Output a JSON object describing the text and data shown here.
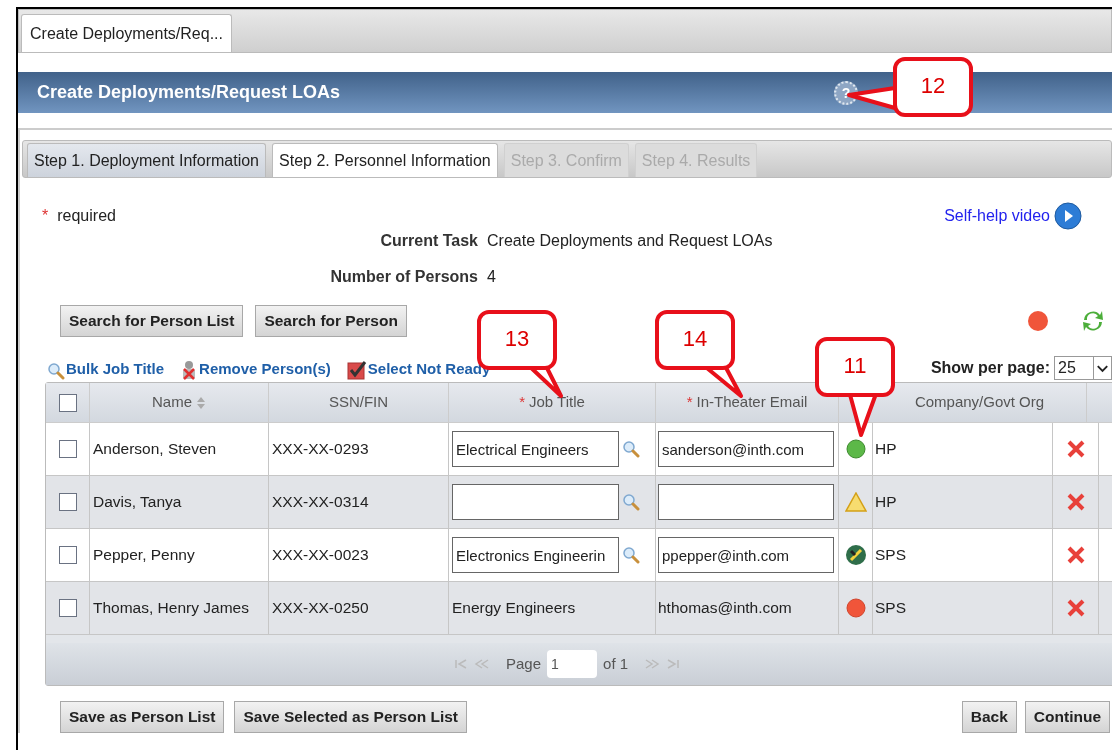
{
  "window_tab": {
    "label": "Create Deployments/Req...",
    "selected": true
  },
  "header": {
    "title": "Create Deployments/Request LOAs",
    "help_icon": "?"
  },
  "steps": [
    {
      "label": "Step 1. Deployment Information",
      "selected": false,
      "disabled": false
    },
    {
      "label": "Step 2. Personnel Information",
      "selected": true,
      "disabled": false
    },
    {
      "label": "Step 3. Confirm",
      "selected": false,
      "disabled": true
    },
    {
      "label": "Step 4. Results",
      "selected": false,
      "disabled": true
    }
  ],
  "required_note": {
    "mark": "*",
    "text": "required"
  },
  "self_help_link": "Self-help video",
  "info": [
    {
      "label": "Current Task",
      "value": "Create Deployments and Request LOAs"
    },
    {
      "label": "Number of Persons",
      "value": "4"
    }
  ],
  "search_buttons": [
    "Search for Person List",
    "Search for Person"
  ],
  "actions": [
    {
      "kind": "search",
      "label": "Bulk Job Title"
    },
    {
      "kind": "remove",
      "label": "Remove Person(s)"
    },
    {
      "kind": "check",
      "label": "Select Not Ready"
    }
  ],
  "per_page": {
    "label": "Show per page:",
    "value": "25"
  },
  "table": {
    "select_all": {
      "checked": false
    },
    "columns": [
      {
        "label": "Name",
        "required": false,
        "sortable": true
      },
      {
        "label": "SSN/FIN",
        "required": false,
        "sortable": false
      },
      {
        "label": "Job Title",
        "required": true,
        "sortable": false
      },
      {
        "label": "In-Theater Email",
        "required": true,
        "sortable": false
      },
      {
        "label": "Company/Govt Org",
        "required": false,
        "sortable": false
      }
    ],
    "required_mark": "*",
    "rows": [
      {
        "checked": false,
        "name": "Anderson, Steven",
        "ssn": "XXX-XX-0293",
        "editable": true,
        "job_title": "Electrical Engineers",
        "email": "sanderson@inth.com",
        "kind": "ready",
        "org": "HP"
      },
      {
        "checked": false,
        "name": "Davis, Tanya",
        "ssn": "XXX-XX-0314",
        "editable": true,
        "kind": "warning",
        "org": "HP"
      },
      {
        "checked": false,
        "name": "Pepper, Penny",
        "ssn": "XXX-XX-0023",
        "editable": true,
        "job_title": "Electronics Engineerin",
        "email": "ppepper@inth.com",
        "kind": "edit",
        "org": "SPS"
      },
      {
        "checked": false,
        "name": "Thomas, Henry James",
        "ssn": "XXX-XX-0250",
        "editable": false,
        "job_title": "Energy Engineers",
        "email": "hthomas@inth.com",
        "kind": "not_ready",
        "org": "SPS"
      }
    ],
    "pager": {
      "label": "Page",
      "page": "1",
      "of": "of 1"
    }
  },
  "bottom_buttons_left": [
    "Save as Person List",
    "Save Selected as Person List"
  ],
  "bottom_buttons_right": [
    "Back",
    "Continue"
  ],
  "callouts": [
    "12",
    "13",
    "14",
    "11"
  ]
}
